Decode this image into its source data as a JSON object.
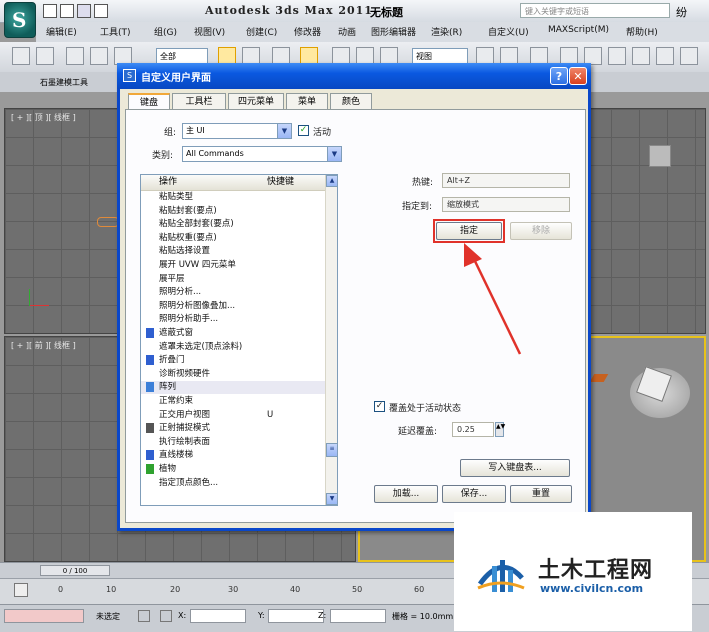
{
  "window": {
    "title": "Autodesk 3ds Max  2011",
    "file_name": "无标题",
    "search_placeholder": "键入关键字或短语",
    "help_glyph": "纷"
  },
  "menu": [
    "编辑(E)",
    "工具(T)",
    "组(G)",
    "视图(V)",
    "创建(C)",
    "修改器",
    "动画",
    "图形编辑器",
    "渲染(R)",
    "自定义(U)",
    "MAXScript(M)",
    "帮助(H)"
  ],
  "toolbar": {
    "selection_filter": "全部",
    "view_dropdown": "视图"
  },
  "ribbon": {
    "tab": "石墨建模工具"
  },
  "viewports": {
    "top_left_label": "[ + ][ 顶 ][ 线框 ]",
    "bottom_left_label": "[ + ][ 前 ][ 线框 ]"
  },
  "dialog": {
    "title": "自定义用户界面",
    "help_button": "?",
    "close_button": "✕",
    "tabs": [
      "键盘",
      "工具栏",
      "四元菜单",
      "菜单",
      "颜色"
    ],
    "group_label": "组:",
    "group_value": "主 UI",
    "active_label": "活动",
    "category_label": "类别:",
    "category_value": "All Commands",
    "list_header_action": "操作",
    "list_header_shortcut": "快捷键",
    "commands": [
      {
        "name": "粘贴类型",
        "key": "",
        "icon": ""
      },
      {
        "name": "粘贴封套(要点)",
        "key": "",
        "icon": ""
      },
      {
        "name": "粘贴全部封套(要点)",
        "key": "",
        "icon": ""
      },
      {
        "name": "粘贴权重(要点)",
        "key": "",
        "icon": ""
      },
      {
        "name": "粘贴选择设置",
        "key": "",
        "icon": ""
      },
      {
        "name": "展开 UVW 四元菜单",
        "key": "",
        "icon": ""
      },
      {
        "name": "展平层",
        "key": "",
        "icon": ""
      },
      {
        "name": "照明分析...",
        "key": "",
        "icon": ""
      },
      {
        "name": "照明分析图像叠加...",
        "key": "",
        "icon": ""
      },
      {
        "name": "照明分析助手...",
        "key": "",
        "icon": ""
      },
      {
        "name": "遮蔽式窗",
        "key": "",
        "icon": "blue"
      },
      {
        "name": "遮罩未选定(顶点涂料)",
        "key": "",
        "icon": ""
      },
      {
        "name": "折叠门",
        "key": "",
        "icon": "blue"
      },
      {
        "name": "诊断视频硬件",
        "key": "",
        "icon": ""
      },
      {
        "name": "阵列",
        "key": "",
        "icon": "array"
      },
      {
        "name": "正常约束",
        "key": "",
        "icon": ""
      },
      {
        "name": "正交用户视图",
        "key": "U",
        "icon": ""
      },
      {
        "name": "正射捕捉模式",
        "key": "",
        "icon": "snap"
      },
      {
        "name": "执行绘制表面",
        "key": "",
        "icon": ""
      },
      {
        "name": "直线楼梯",
        "key": "",
        "icon": "blue"
      },
      {
        "name": "植物",
        "key": "",
        "icon": "green"
      },
      {
        "name": "指定顶点颜色...",
        "key": "",
        "icon": ""
      }
    ],
    "hotkey_label": "热键:",
    "hotkey_value": "Alt+Z",
    "assigned_label": "指定到:",
    "assigned_value": "缩放模式",
    "assign_button": "指定",
    "remove_button": "移除",
    "override_label": "覆盖处于活动状态",
    "delay_label": "延迟覆盖:",
    "delay_value": "0.25",
    "write_button": "写入键盘表...",
    "load_button": "加载...",
    "save_button": "保存...",
    "reset_button": "重置"
  },
  "timeline": {
    "frame_slider": "0 / 100",
    "ticks": [
      "0",
      "10",
      "20",
      "30",
      "40",
      "50",
      "60"
    ]
  },
  "status": {
    "selection": "未选定",
    "x_label": "X:",
    "y_label": "Y:",
    "z_label": "Z:",
    "grid": "栅格 = 10.0mm"
  },
  "watermark": {
    "title": "土木工程网",
    "url": "www.civilcn.com"
  },
  "colors": {
    "highlight_red": "#e0322a",
    "dialog_blue": "#0a58e0",
    "viewport_gray": "#6f6f6f"
  }
}
